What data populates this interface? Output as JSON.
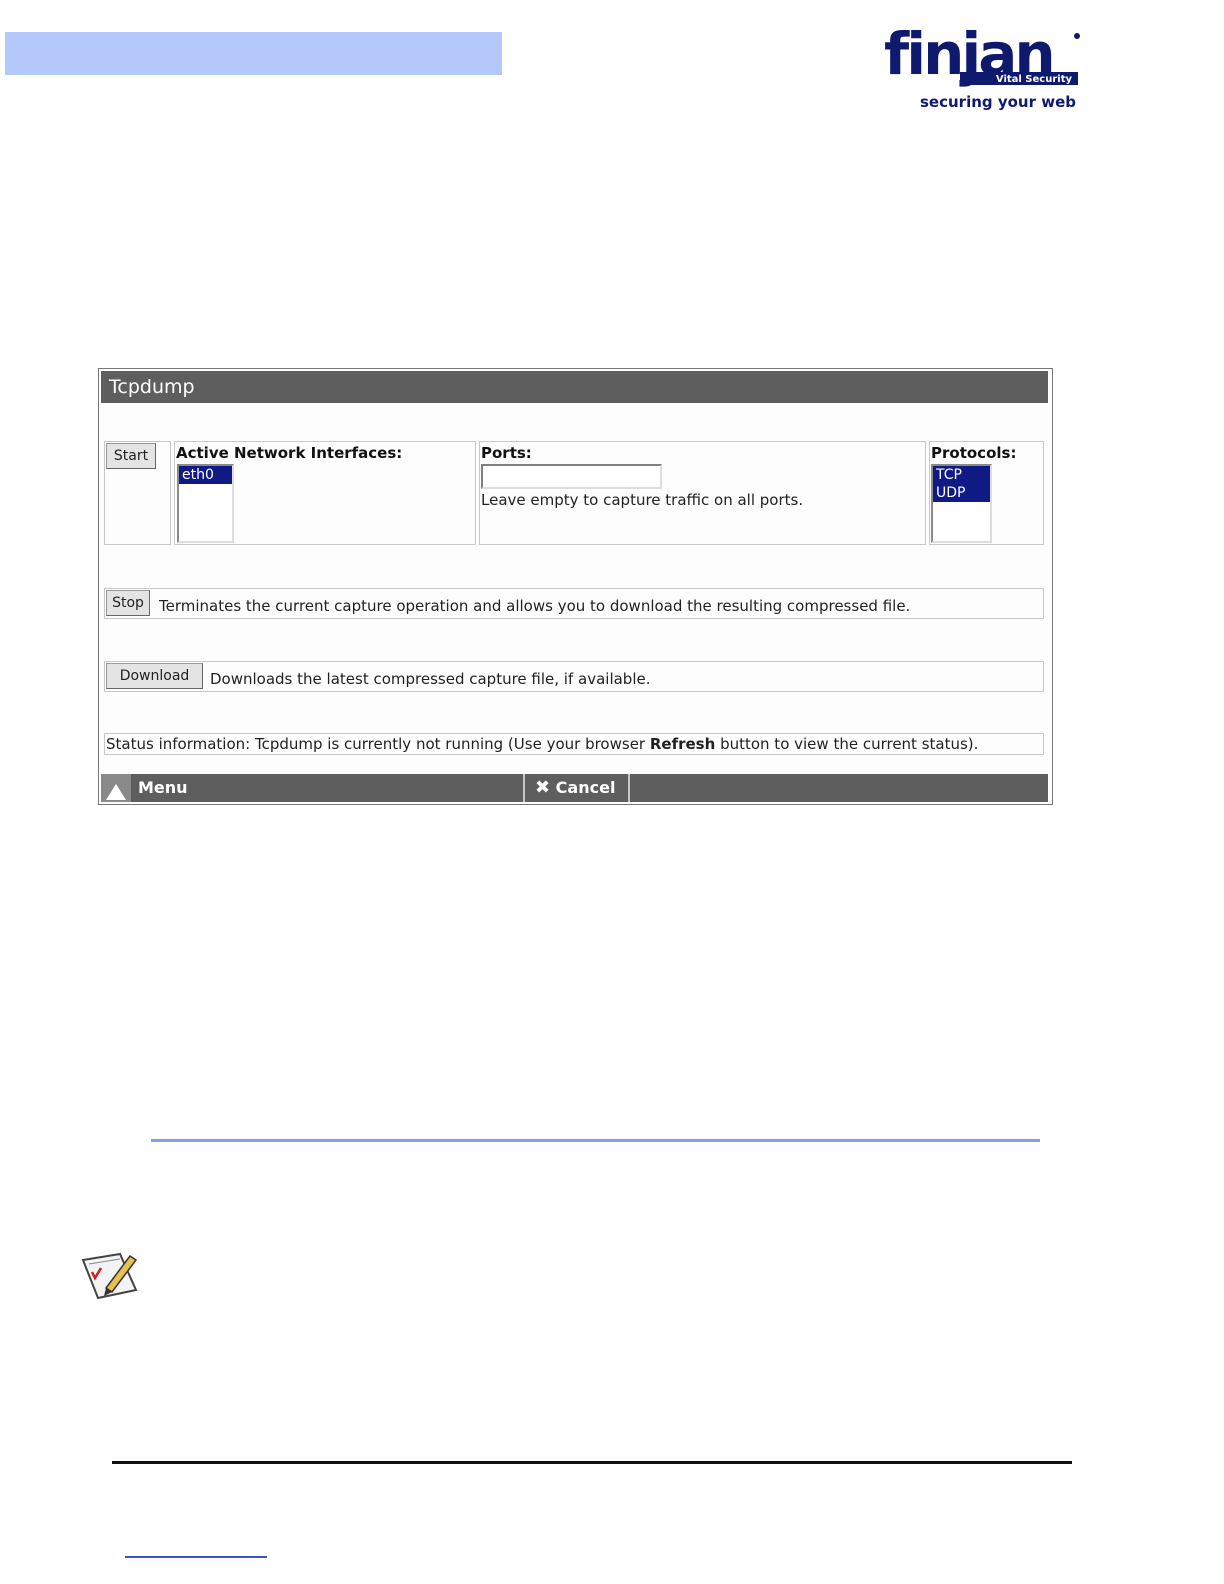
{
  "logo": {
    "brand": "finjan",
    "product": "Vital Security",
    "tagline": "securing your web"
  },
  "tcpdump": {
    "title": "Tcpdump",
    "start_label": "Start",
    "interfaces": {
      "label": "Active Network Interfaces:",
      "options": [
        "eth0"
      ]
    },
    "ports": {
      "label": "Ports:",
      "value": "",
      "hint": "Leave empty to capture traffic on all ports."
    },
    "protocols": {
      "label": "Protocols:",
      "options": [
        "TCP",
        "UDP"
      ]
    },
    "stop": {
      "label": "Stop",
      "description": "Terminates the current capture operation and allows you to download the resulting compressed file."
    },
    "download": {
      "label": "Download",
      "description": "Downloads the latest compressed capture file, if available."
    },
    "status": {
      "prefix": "Status information: Tcpdump is currently not running (Use your browser ",
      "emphasis": "Refresh",
      "suffix": " button to view the current status)."
    },
    "menu_label": "Menu",
    "cancel_label": "Cancel"
  },
  "colors": {
    "header_bar": "#b4c8fc",
    "panel_bar": "#5e5e5e",
    "selected_option": "#0f1a84",
    "brand": "#0f1a6e"
  }
}
